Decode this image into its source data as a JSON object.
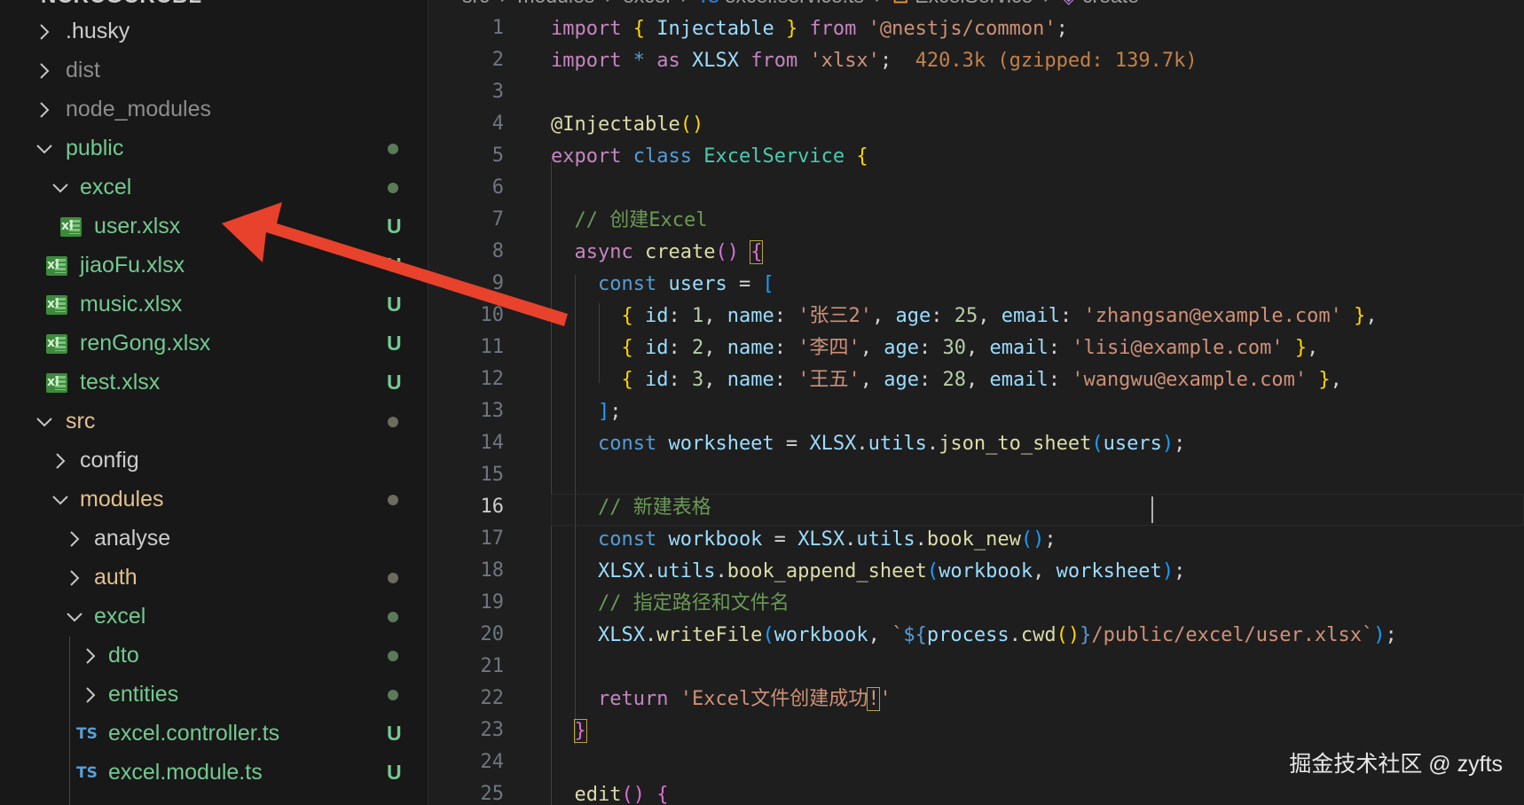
{
  "explorer": {
    "title": "NCRCGCRCBL",
    "items": [
      {
        "label": ".husky",
        "status": ""
      },
      {
        "label": "dist",
        "status": ""
      },
      {
        "label": "node_modules",
        "status": ""
      },
      {
        "label": "public",
        "status": ""
      },
      {
        "label": "excel",
        "status": ""
      },
      {
        "label": "user.xlsx",
        "status": "U"
      },
      {
        "label": "jiaoFu.xlsx",
        "status": "U"
      },
      {
        "label": "music.xlsx",
        "status": "U"
      },
      {
        "label": "renGong.xlsx",
        "status": "U"
      },
      {
        "label": "test.xlsx",
        "status": "U"
      },
      {
        "label": "src",
        "status": ""
      },
      {
        "label": "config",
        "status": ""
      },
      {
        "label": "modules",
        "status": ""
      },
      {
        "label": "analyse",
        "status": ""
      },
      {
        "label": "auth",
        "status": ""
      },
      {
        "label": "excel",
        "status": ""
      },
      {
        "label": "dto",
        "status": ""
      },
      {
        "label": "entities",
        "status": ""
      },
      {
        "label": "excel.controller.ts",
        "status": "U"
      },
      {
        "label": "excel.module.ts",
        "status": "U"
      }
    ],
    "icons": {
      "xlsx": "xl",
      "ts": "TS"
    }
  },
  "breadcrumb": {
    "parts": [
      "src",
      "modules",
      "excel",
      "excel.service.ts",
      "ExcelService",
      "create"
    ]
  },
  "editor": {
    "active_line": 16,
    "line_numbers": [
      "1",
      "2",
      "3",
      "4",
      "5",
      "6",
      "7",
      "8",
      "9",
      "10",
      "11",
      "12",
      "13",
      "14",
      "15",
      "16",
      "17",
      "18",
      "19",
      "20",
      "21",
      "22",
      "23",
      "24",
      "25"
    ],
    "import_cost": "420.3k (gzipped: 139.7k)"
  },
  "colors": {
    "keyword": "#c586c0",
    "string": "#ce9178",
    "comment": "#6a9955",
    "function": "#dcdcaa",
    "variable": "#9cdcfe",
    "untracked": "#73c991",
    "annotation_arrow": "#e8412c"
  },
  "watermark": "掘金技术社区 @ zyfts"
}
